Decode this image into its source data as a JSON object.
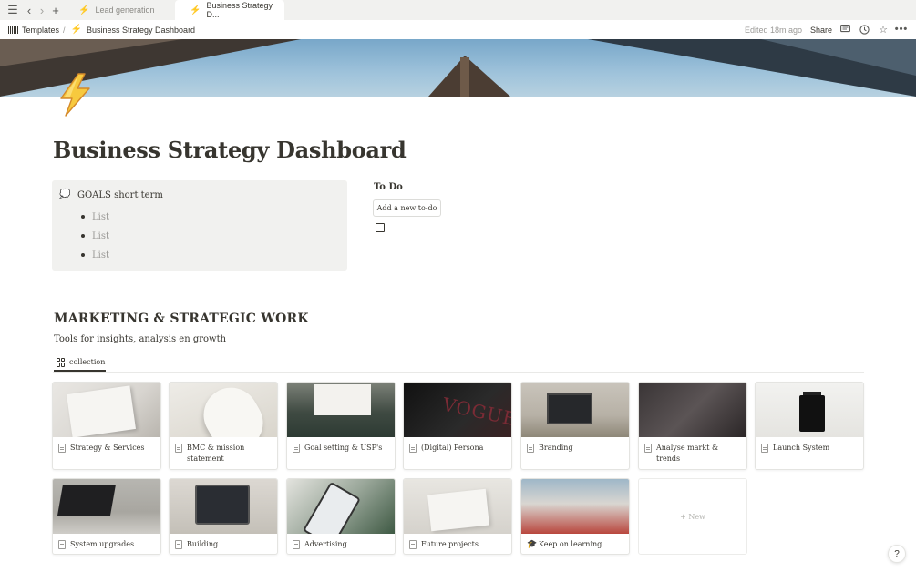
{
  "browser": {
    "tabs": [
      {
        "label": "Lead generation",
        "icon": "bolt-icon",
        "active": false
      },
      {
        "label": "Business Strategy D...",
        "icon": "bolt-icon",
        "active": true
      }
    ]
  },
  "topbar": {
    "breadcrumb": [
      {
        "label": "Templates",
        "icon": "templates-icon"
      },
      {
        "label": "Business Strategy Dashboard",
        "icon": "bolt-icon"
      }
    ],
    "separator": "/",
    "edited": "Edited 18m ago",
    "share_label": "Share"
  },
  "page": {
    "icon": "lightning-bolt-icon",
    "title": "Business Strategy Dashboard"
  },
  "goals": {
    "icon": "speech-bubble-icon",
    "title": "GOALS short term",
    "items": [
      "List",
      "List",
      "List"
    ]
  },
  "todo": {
    "title": "To Do",
    "button_label": "Add a new to-do"
  },
  "section": {
    "title": "MARKETING & STRATEGIC WORK",
    "subtitle": "Tools for insights, analysis en growth",
    "view_tab": "collection"
  },
  "gallery": {
    "cards": [
      {
        "title": "Strategy & Services",
        "icon": "page-icon"
      },
      {
        "title": "BMC & mission statement",
        "icon": "page-icon"
      },
      {
        "title": "Goal setting & USP's",
        "icon": "page-icon"
      },
      {
        "title": "(Digital) Persona",
        "icon": "page-icon"
      },
      {
        "title": "Branding",
        "icon": "page-icon"
      },
      {
        "title": "Analyse markt & trends",
        "icon": "page-icon"
      },
      {
        "title": "Launch System",
        "icon": "page-icon"
      },
      {
        "title": "System upgrades",
        "icon": "page-icon"
      },
      {
        "title": "Building",
        "icon": "page-icon"
      },
      {
        "title": "Advertising",
        "icon": "page-icon"
      },
      {
        "title": "Future projects",
        "icon": "page-icon"
      },
      {
        "title": "Keep on learning",
        "icon": "graduation-cap-icon",
        "emoji": "🎓"
      }
    ],
    "new_label": "+ New"
  },
  "help_label": "?"
}
